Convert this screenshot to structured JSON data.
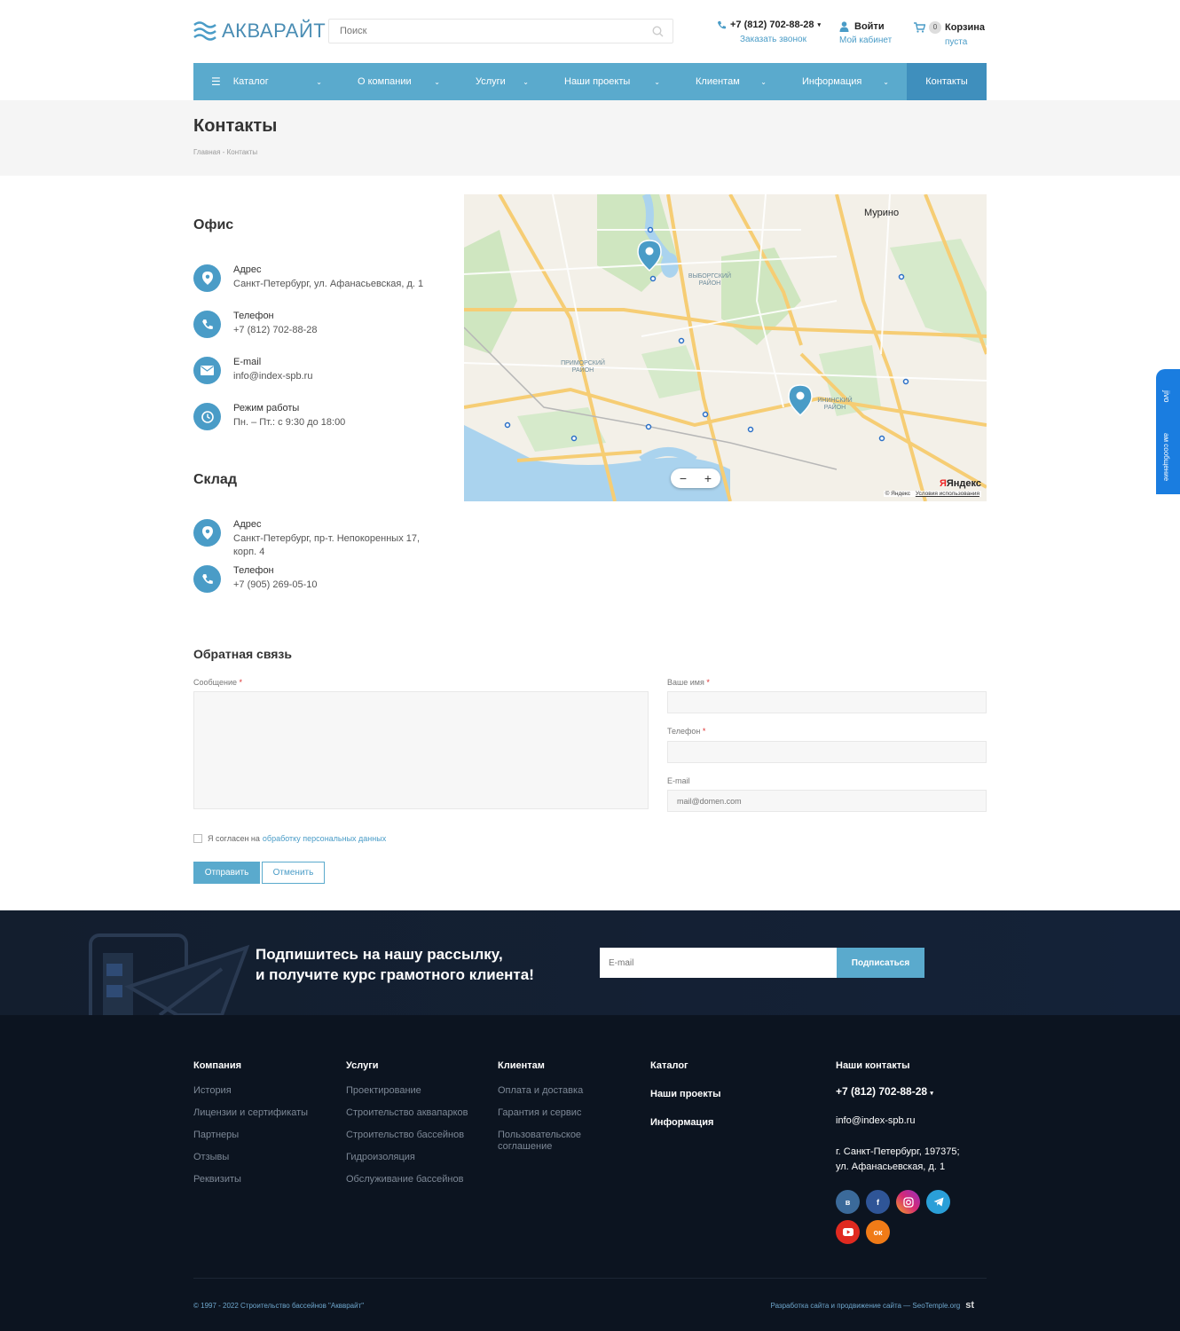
{
  "header": {
    "logo_text": "АКВАРАЙТ",
    "search_placeholder": "Поиск",
    "phone": "+7 (812) 702-88-28",
    "callback": "Заказать звонок",
    "login": "Войти",
    "cabinet": "Мой кабинет",
    "cart": "Корзина",
    "cart_count": "0",
    "cart_status": "пуста"
  },
  "nav": {
    "items": [
      {
        "label": "Каталог"
      },
      {
        "label": "О компании"
      },
      {
        "label": "Услуги"
      },
      {
        "label": "Наши проекты"
      },
      {
        "label": "Клиентам"
      },
      {
        "label": "Информация"
      },
      {
        "label": "Контакты"
      }
    ]
  },
  "page": {
    "title": "Контакты",
    "breadcrumb_home": "Главная",
    "breadcrumb_sep": "-",
    "breadcrumb_current": "Контакты"
  },
  "office": {
    "title": "Офис",
    "address_label": "Адрес",
    "address": "Санкт-Петербург, ул. Афанасьевская, д. 1",
    "phone_label": "Телефон",
    "phone": "+7 (812) 702-88-28",
    "email_label": "E-mail",
    "email": "info@index-spb.ru",
    "hours_label": "Режим работы",
    "hours": "Пн. – Пт.: с 9:30 до 18:00"
  },
  "warehouse": {
    "title": "Склад",
    "address_label": "Адрес",
    "address": "Санкт-Петербург, пр-т. Непокоренных 17, корп. 4",
    "phone_label": "Телефон",
    "phone": "+7 (905) 269-05-10"
  },
  "map": {
    "city": "Мурино",
    "district1": "ВЫБОРГСКИЙ РАЙОН",
    "district2": "ПРИМОРСКИЙ РАЙОН",
    "district3": "ИНИНСКИЙ РАЙОН",
    "zoom_out": "−",
    "zoom_in": "+",
    "provider": "Яндекс",
    "copyright": "© Яндекс",
    "terms": "Условия использования"
  },
  "feedback": {
    "title": "Обратная связь",
    "message_label": "Сообщение",
    "name_label": "Ваше имя",
    "phone_label": "Телефон",
    "email_label": "E-mail",
    "email_placeholder": "mail@domen.com",
    "required_mark": "*",
    "agree_text": "Я согласен на",
    "agree_link": "обработку персональных данных",
    "submit": "Отправить",
    "cancel": "Отменить"
  },
  "subscribe": {
    "line1": "Подпишитесь на нашу рассылку,",
    "line2": "и получите курс грамотного клиента!",
    "placeholder": "E-mail",
    "button": "Подписаться"
  },
  "footer": {
    "company": {
      "title": "Компания",
      "links": [
        "История",
        "Лицензии и сертификаты",
        "Партнеры",
        "Отзывы",
        "Реквизиты"
      ]
    },
    "services": {
      "title": "Услуги",
      "links": [
        "Проектирование",
        "Строительство аквапарков",
        "Строительство бассейнов",
        "Гидроизоляция",
        "Обслуживание бассейнов"
      ]
    },
    "clients": {
      "title": "Клиентам",
      "links": [
        "Оплата и доставка",
        "Гарантия и сервис",
        "Пользовательское соглашение"
      ]
    },
    "catalog": {
      "title": "Каталог",
      "links": [
        "Наши проекты",
        "Информация"
      ]
    },
    "contacts": {
      "title": "Наши контакты",
      "phone": "+7 (812) 702-88-28",
      "email": "info@index-spb.ru",
      "address_line1": "г. Санкт-Петербург, 197375;",
      "address_line2": "ул. Афанасьевская, д. 1"
    },
    "copyright": "© 1997 - 2022 Строительство бассейнов \"Аквврайт\"",
    "developer": "Разработка сайта и продвижение сайта — SeoTemple.org",
    "dev_logo": "st"
  },
  "jivo": {
    "title": "jivo",
    "message": "ам сообщение"
  },
  "colors": {
    "accent": "#5aaacd",
    "accent_dark": "#3f8fbd",
    "footer_bg": "#0c1420"
  }
}
